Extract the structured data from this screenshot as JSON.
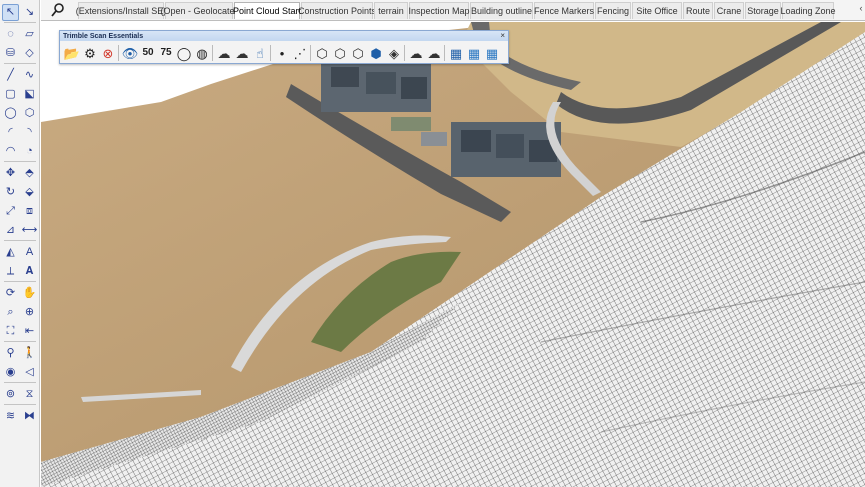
{
  "left_toolbar": {
    "tools": [
      {
        "name": "select-tool",
        "glyph": "↖",
        "selected": true
      },
      {
        "name": "select-dropdown-tool",
        "glyph": "↘",
        "selected": false
      },
      {
        "name": "lasso-tool",
        "glyph": "◌",
        "selected": false
      },
      {
        "name": "eraser-tool",
        "glyph": "▱",
        "selected": false
      },
      {
        "name": "paint-bucket-tool",
        "glyph": "⛁",
        "selected": false
      },
      {
        "name": "eraser-alt-tool",
        "glyph": "◇",
        "selected": false
      },
      {
        "name": "line-tool",
        "glyph": "╱",
        "selected": false
      },
      {
        "name": "freehand-tool",
        "glyph": "∿",
        "selected": false
      },
      {
        "name": "rectangle-tool",
        "glyph": "▢",
        "selected": false
      },
      {
        "name": "rotated-rectangle-tool",
        "glyph": "⬕",
        "selected": false
      },
      {
        "name": "circle-tool",
        "glyph": "◯",
        "selected": false
      },
      {
        "name": "polygon-tool",
        "glyph": "⬡",
        "selected": false
      },
      {
        "name": "arc-tool",
        "glyph": "◜",
        "selected": false
      },
      {
        "name": "two-point-arc-tool",
        "glyph": "◝",
        "selected": false
      },
      {
        "name": "three-point-arc-tool",
        "glyph": "◠",
        "selected": false
      },
      {
        "name": "pie-tool",
        "glyph": "◔",
        "selected": false
      },
      {
        "name": "move-tool",
        "glyph": "✥",
        "selected": false
      },
      {
        "name": "push-pull-tool",
        "glyph": "⬘",
        "selected": false
      },
      {
        "name": "rotate-tool",
        "glyph": "↻",
        "selected": false
      },
      {
        "name": "follow-me-tool",
        "glyph": "⬙",
        "selected": false
      },
      {
        "name": "scale-tool",
        "glyph": "⤢",
        "selected": false
      },
      {
        "name": "offset-tool",
        "glyph": "⧈",
        "selected": false
      },
      {
        "name": "tape-measure-tool",
        "glyph": "⊿",
        "selected": false
      },
      {
        "name": "dimension-tool",
        "glyph": "⟷",
        "selected": false
      },
      {
        "name": "protractor-tool",
        "glyph": "◭",
        "selected": false
      },
      {
        "name": "text-tool",
        "glyph": "A",
        "selected": false
      },
      {
        "name": "axes-tool",
        "glyph": "⟂",
        "selected": false
      },
      {
        "name": "3d-text-tool",
        "glyph": "𝐀",
        "selected": false
      },
      {
        "name": "orbit-tool",
        "glyph": "⟳",
        "selected": false
      },
      {
        "name": "pan-tool",
        "glyph": "✋",
        "selected": false
      },
      {
        "name": "zoom-tool",
        "glyph": "⌕",
        "selected": false
      },
      {
        "name": "zoom-window-tool",
        "glyph": "⊕",
        "selected": false
      },
      {
        "name": "zoom-extents-tool",
        "glyph": "⛶",
        "selected": false
      },
      {
        "name": "previous-view-tool",
        "glyph": "⇤",
        "selected": false
      },
      {
        "name": "position-camera-tool",
        "glyph": "⚲",
        "selected": false
      },
      {
        "name": "walk-tool",
        "glyph": "🚶",
        "selected": false
      },
      {
        "name": "look-around-tool",
        "glyph": "◉",
        "selected": false
      },
      {
        "name": "section-plane-tool",
        "glyph": "◁",
        "selected": false
      },
      {
        "name": "sandbox-tool",
        "glyph": "⊚",
        "selected": false
      },
      {
        "name": "terrain-tool",
        "glyph": "⧖",
        "selected": false
      },
      {
        "name": "layers-tool",
        "glyph": "≋",
        "selected": false
      },
      {
        "name": "stamp-tool",
        "glyph": "⧓",
        "selected": false
      }
    ]
  },
  "tabs": {
    "search_icon": "search-icon",
    "items": [
      {
        "label": "(Extensions/Install SE)",
        "active": false
      },
      {
        "label": "(Open - Geolocate)",
        "active": false
      },
      {
        "label": "Point Cloud Start",
        "active": true
      },
      {
        "label": "Construction Points",
        "active": false
      },
      {
        "label": "terrain",
        "active": false
      },
      {
        "label": "Inspection Map",
        "active": false
      },
      {
        "label": "Building outline",
        "active": false
      },
      {
        "label": "Fence Markers",
        "active": false
      },
      {
        "label": "Fencing",
        "active": false
      },
      {
        "label": "Site Office",
        "active": false
      },
      {
        "label": "Route",
        "active": false
      },
      {
        "label": "Crane",
        "active": false
      },
      {
        "label": "Storage",
        "active": false
      },
      {
        "label": "Loading Zone",
        "active": false
      }
    ],
    "scroll_glyph": "‹"
  },
  "scan_panel": {
    "title": "Trimble Scan Essentials",
    "close_glyph": "×",
    "tools": [
      {
        "name": "open-folder-icon",
        "glyph": "📂",
        "color": "#333333"
      },
      {
        "name": "settings-gear-icon",
        "glyph": "⚙",
        "color": "#222222"
      },
      {
        "name": "cancel-icon",
        "glyph": "⊗",
        "color": "#d33a2c"
      },
      {
        "name": "scan-visibility-icon",
        "glyph": "👁",
        "color": "#1f5fa8"
      },
      {
        "name": "density-50-icon",
        "glyph": "50",
        "color": "#1e1e1e",
        "badge": true
      },
      {
        "name": "density-75-icon",
        "glyph": "75",
        "color": "#1e1e1e",
        "badge": true
      },
      {
        "name": "point-size-drop-icon",
        "glyph": "◯",
        "color": "#222222"
      },
      {
        "name": "point-color-drop-icon",
        "glyph": "◍",
        "color": "#222222"
      },
      {
        "name": "cloud-upload-icon",
        "glyph": "☁",
        "color": "#333333"
      },
      {
        "name": "cloud-download-icon",
        "glyph": "☁",
        "color": "#333333"
      },
      {
        "name": "hand-select-icon",
        "glyph": "☝",
        "color": "#1f5fa8"
      },
      {
        "name": "point-tool-icon",
        "glyph": "•",
        "color": "#222222"
      },
      {
        "name": "line-segment-icon",
        "glyph": "⋰",
        "color": "#222222"
      },
      {
        "name": "fit-plane-icon",
        "glyph": "⬡",
        "color": "#333333"
      },
      {
        "name": "fit-cylinder-icon",
        "glyph": "⬡",
        "color": "#333333"
      },
      {
        "name": "fit-box-icon",
        "glyph": "⬡",
        "color": "#333333"
      },
      {
        "name": "fit-shape-icon",
        "glyph": "⬢",
        "color": "#1f5fa8"
      },
      {
        "name": "measure-box-icon",
        "glyph": "◈",
        "color": "#333333"
      },
      {
        "name": "cloud-sync-icon",
        "glyph": "☁",
        "color": "#333333"
      },
      {
        "name": "cloud-export-icon",
        "glyph": "☁",
        "color": "#333333"
      },
      {
        "name": "surface-mesh-icon",
        "glyph": "▦",
        "color": "#1f5fa8"
      },
      {
        "name": "surface-grid-icon",
        "glyph": "▦",
        "color": "#2b78c2"
      },
      {
        "name": "surface-terrain-icon",
        "glyph": "▦",
        "color": "#2b78c2"
      }
    ]
  },
  "colors": {
    "terrain_base": "#c2a37b",
    "terrain_dark": "#a5865e",
    "road": "#555555",
    "mesh_line": "#2a2a2a",
    "sky": "#ffffff",
    "accent": "#7aa0d4"
  }
}
